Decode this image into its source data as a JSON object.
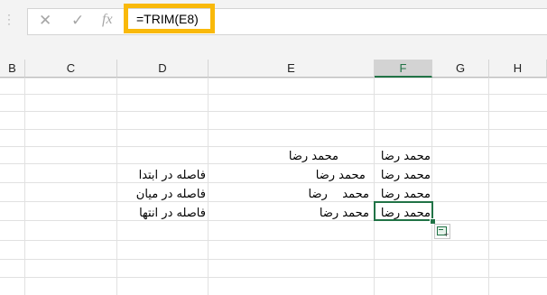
{
  "formula_bar": {
    "cancel_glyph": "✕",
    "enter_glyph": "✓",
    "function_glyph": "fx",
    "formula": "=TRIM(E8)"
  },
  "columns": [
    "B",
    "C",
    "D",
    "E",
    "F",
    "G",
    "H"
  ],
  "active_column": "F",
  "cells": {
    "E6": "محمد رضا",
    "F6": "محمد رضا",
    "D7": "فاصله در ابتدا",
    "E7": " محمد رضا",
    "F7": "محمد رضا",
    "D8": "فاصله در میان",
    "E8": "محمد    رضا",
    "F8": "محمد رضا",
    "D9": "فاصله در انتها",
    "E9": "محمد رضا ",
    "F9": "محمد رضا"
  },
  "selected_cell": "F9",
  "colors": {
    "accent": "#217346",
    "highlight": "#f9b90a"
  },
  "icons": [
    "options-dots-icon",
    "cancel-icon",
    "enter-icon",
    "function-icon",
    "paste-options-icon"
  ]
}
